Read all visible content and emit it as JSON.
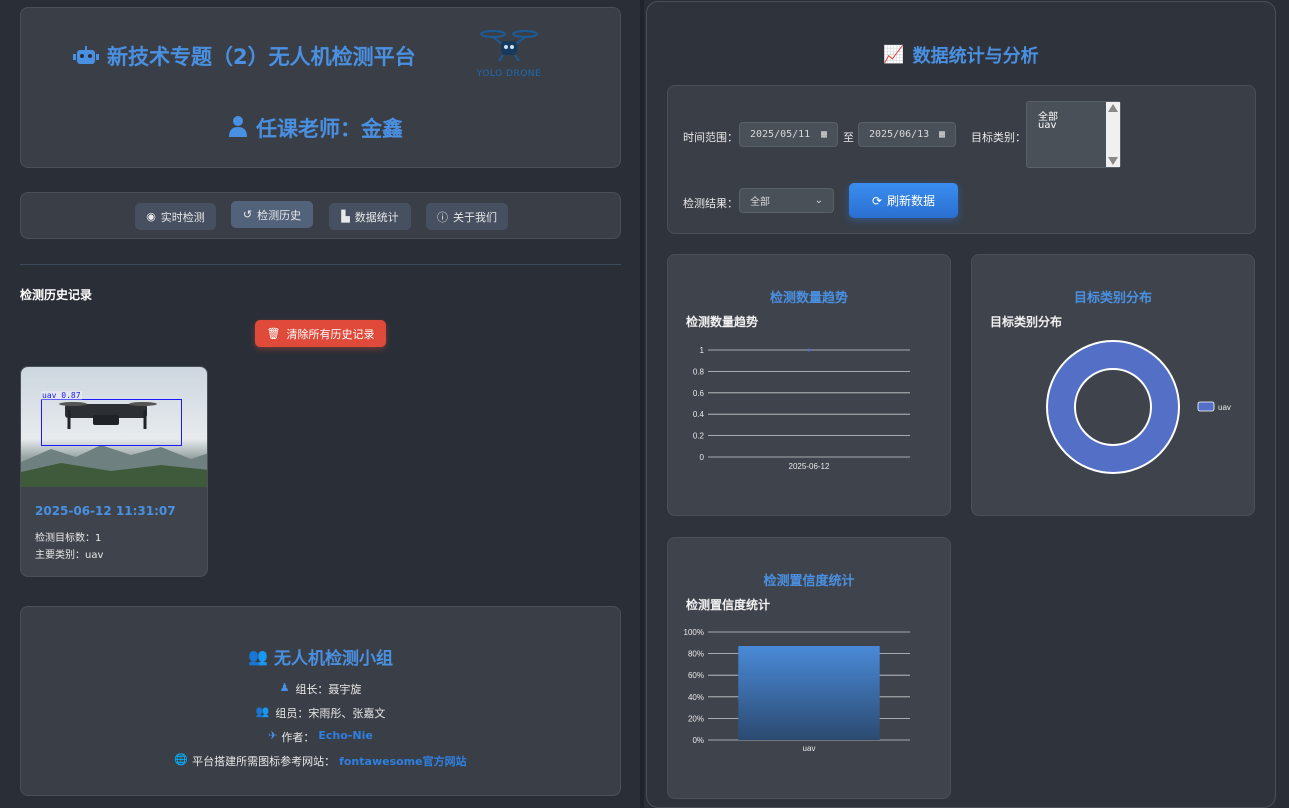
{
  "header": {
    "title": "新技术专题（2）无人机检测平台",
    "teacher": "任课老师：金鑫",
    "logo_text": "YOLO DRONE"
  },
  "nav": {
    "items": [
      {
        "label": "实时检测",
        "icon": "camera-icon"
      },
      {
        "label": "检测历史",
        "icon": "history-icon"
      },
      {
        "label": "数据统计",
        "icon": "chart-icon"
      },
      {
        "label": "关于我们",
        "icon": "info-icon"
      }
    ]
  },
  "history": {
    "heading": "检测历史记录",
    "clear_button": "清除所有历史记录",
    "records": [
      {
        "timestamp": "2025-06-12 11:31:07",
        "count": "检测目标数：1",
        "category": "主要类别：uav",
        "box_label": "uav 0.87"
      }
    ]
  },
  "team": {
    "title": "无人机检测小组",
    "leader": "组长：聂宇旋",
    "members": "组员：宋雨彤、张嘉文",
    "author_label": "作者：",
    "author_name": "Echo-Nie",
    "site_label": "平台搭建所需图标参考网站：",
    "site_link": "fontawesome官方网站"
  },
  "stats": {
    "title": "数据统计与分析",
    "time_range_label": "时间范围：",
    "date_from": "2025/05/11",
    "to_label": "至",
    "date_to": "2025/06/13",
    "category_label": "目标类别：",
    "category_options": [
      "全部",
      "uav"
    ],
    "result_label": "检测结果：",
    "result_value": "全部",
    "refresh_button": "刷新数据"
  },
  "chart_data": [
    {
      "type": "line",
      "card_title": "检测数量趋势",
      "title": "检测数量趋势",
      "x": [
        "2025-06-12"
      ],
      "series": [
        {
          "values": [
            1
          ]
        }
      ],
      "ylim": [
        0,
        1
      ],
      "yticks": [
        "0",
        "0.2",
        "0.4",
        "0.6",
        "0.8",
        "1"
      ],
      "grid": true
    },
    {
      "type": "pie",
      "card_title": "目标类别分布",
      "title": "目标类别分布",
      "categories": [
        "uav"
      ],
      "values": [
        1
      ],
      "legend": "right",
      "color": "#5470c6"
    },
    {
      "type": "bar",
      "card_title": "检测置信度统计",
      "title": "检测置信度统计",
      "categories": [
        "uav"
      ],
      "values": [
        87
      ],
      "ylim": [
        0,
        100
      ],
      "yticks": [
        "0%",
        "20%",
        "40%",
        "60%",
        "80%",
        "100%"
      ],
      "grid": true
    }
  ],
  "colors": {
    "accent": "#4a90e2",
    "danger": "#e04a3a",
    "bg": "#2a2f37",
    "panel": "#3a3f47"
  }
}
